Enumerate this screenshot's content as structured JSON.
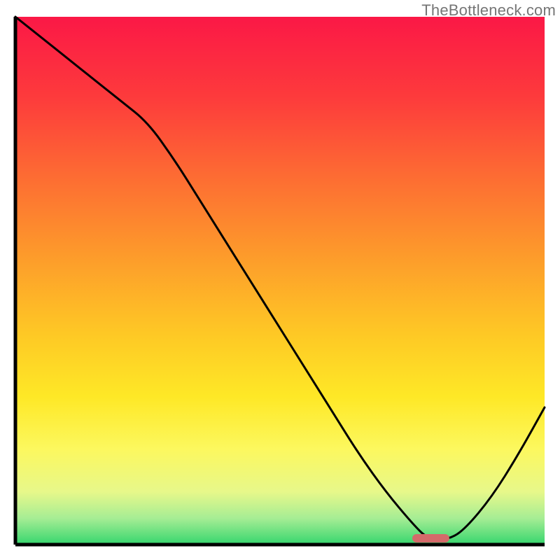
{
  "watermark": "TheBottleneck.com",
  "chart_data": {
    "type": "line",
    "title": "",
    "xlabel": "",
    "ylabel": "",
    "xlim": [
      0,
      100
    ],
    "ylim": [
      0,
      100
    ],
    "x": [
      0,
      5,
      10,
      15,
      20,
      25,
      30,
      35,
      40,
      45,
      50,
      55,
      60,
      65,
      70,
      75,
      78,
      82,
      85,
      90,
      95,
      100
    ],
    "values": [
      100,
      96,
      92,
      88,
      84,
      80,
      73,
      65,
      57,
      49,
      41,
      33,
      25,
      17,
      10,
      4,
      1,
      1,
      3,
      9,
      17,
      26
    ],
    "marker": {
      "x_start": 75,
      "x_end": 82,
      "y": 1.2
    },
    "gradient_stops": [
      {
        "offset": 0.0,
        "color": "#fb1846"
      },
      {
        "offset": 0.15,
        "color": "#fd3a3c"
      },
      {
        "offset": 0.3,
        "color": "#fd6b33"
      },
      {
        "offset": 0.45,
        "color": "#fd9a2b"
      },
      {
        "offset": 0.6,
        "color": "#fec825"
      },
      {
        "offset": 0.72,
        "color": "#fee826"
      },
      {
        "offset": 0.82,
        "color": "#fcf85f"
      },
      {
        "offset": 0.9,
        "color": "#e7f88a"
      },
      {
        "offset": 0.95,
        "color": "#a6ed94"
      },
      {
        "offset": 1.0,
        "color": "#35d66e"
      }
    ],
    "marker_color": "#d46a6a",
    "curve_color": "#000000",
    "frame_color": "#000000"
  }
}
